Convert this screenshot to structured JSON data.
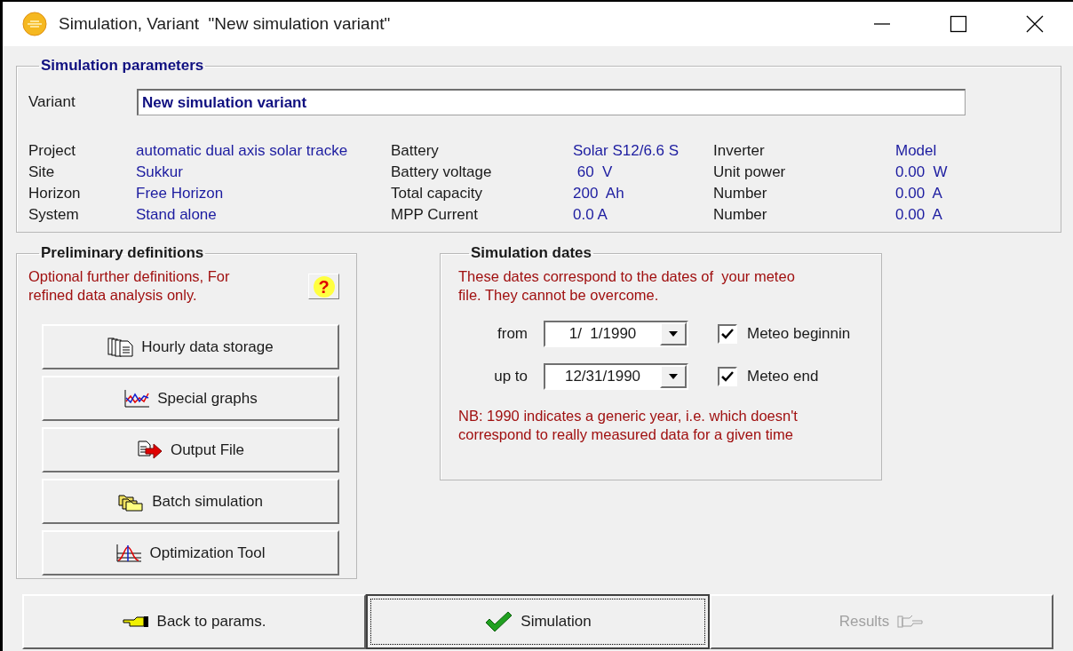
{
  "window": {
    "title": "Simulation, Variant  \"New simulation variant\""
  },
  "simulation_parameters": {
    "title": "Simulation parameters",
    "variant": {
      "label": "Variant",
      "value": "New simulation variant"
    },
    "rows": [
      {
        "items": [
          {
            "label": "Project",
            "value": "automatic dual axis solar tracke"
          },
          {
            "label": "Battery",
            "value": "Solar S12/6.6 S"
          },
          {
            "label": "Inverter",
            "value": "Model"
          }
        ]
      },
      {
        "items": [
          {
            "label": "Site",
            "value": "Sukkur"
          },
          {
            "label": "Battery voltage",
            "value": " 60  V"
          },
          {
            "label": "Unit power",
            "value": "0.00  W"
          }
        ]
      },
      {
        "items": [
          {
            "label": "Horizon",
            "value": "Free Horizon"
          },
          {
            "label": "Total capacity",
            "value": "200  Ah"
          },
          {
            "label": "Number",
            "value": "0.00  A"
          }
        ]
      },
      {
        "items": [
          {
            "label": "System",
            "value": "Stand alone"
          },
          {
            "label": "MPP Current",
            "value": "0.0 A"
          },
          {
            "label": "Number",
            "value": "0.00  A"
          }
        ]
      }
    ]
  },
  "preliminary_definitions": {
    "title": "Preliminary definitions",
    "note": "Optional further definitions, For\nrefined data analysis only.",
    "help": "?",
    "buttons": [
      {
        "label": "Hourly data storage"
      },
      {
        "label": "Special graphs"
      },
      {
        "label": "Output File"
      },
      {
        "label": "Batch simulation"
      },
      {
        "label": "Optimization Tool"
      }
    ]
  },
  "simulation_dates": {
    "title": "Simulation dates",
    "note": "These dates correspond to the dates of  your meteo\nfile. They cannot be overcome.",
    "dates": [
      {
        "label": "from",
        "value": "1/  1/1990",
        "option": {
          "label": "Meteo beginnin",
          "checked": true
        }
      },
      {
        "label": "up to",
        "value": "12/31/1990",
        "option": {
          "label": "Meteo end",
          "checked": true
        }
      }
    ],
    "footnote": "NB: 1990 indicates a generic year, i.e. which doesn't\ncorrespond to really measured data for a given time"
  },
  "buttons": [
    {
      "label": "Back to params.",
      "focused": false,
      "disabled": false
    },
    {
      "label": "Simulation",
      "focused": true,
      "disabled": false
    },
    {
      "label": "Results",
      "focused": false,
      "disabled": true
    }
  ]
}
